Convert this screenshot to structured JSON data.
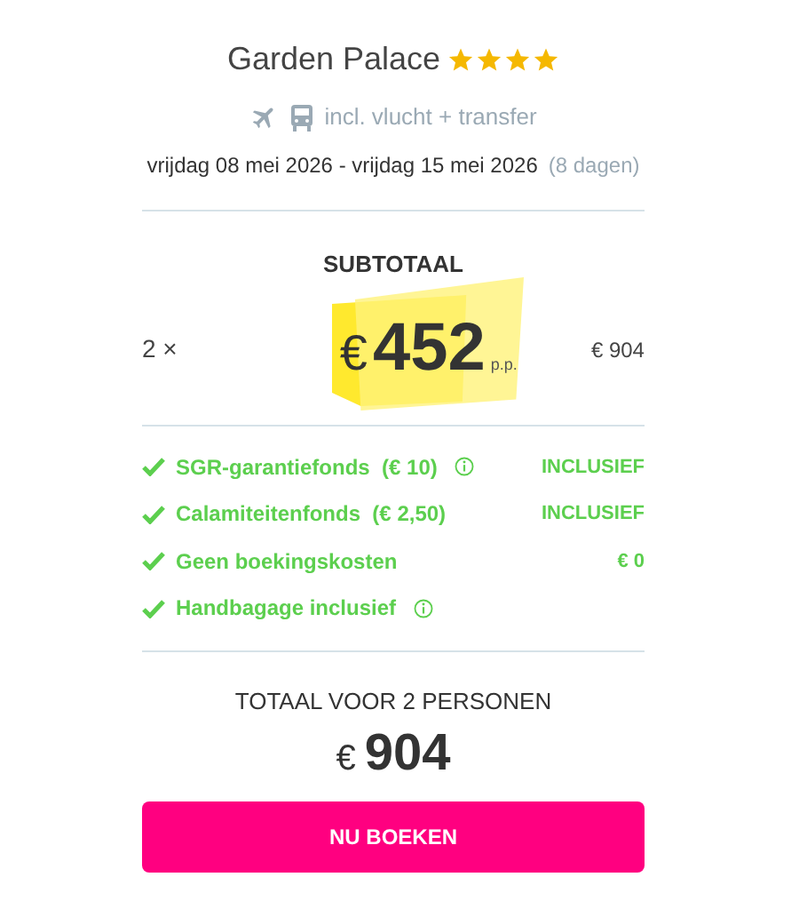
{
  "hotel": {
    "name": "Garden Palace",
    "stars": 4,
    "includes": "incl. vlucht + transfer",
    "dates": "vrijdag 08 mei 2026 - vrijdag 15 mei 2026",
    "duration": "(8 dagen)"
  },
  "subtotal": {
    "title": "SUBTOTAAL",
    "quantity": "2 ×",
    "currency": "€",
    "price": "452",
    "per": "p.p.",
    "amount": "€ 904"
  },
  "features": [
    {
      "label": "SGR-garantiefonds  (€ 10)",
      "info": true,
      "value": "INCLUSIEF"
    },
    {
      "label": "Calamiteitenfonds  (€ 2,50)",
      "info": false,
      "value": "INCLUSIEF"
    },
    {
      "label": "Geen boekingskosten",
      "info": false,
      "value": "€ 0"
    },
    {
      "label": "Handbagage inclusief",
      "info": true
    }
  ],
  "total": {
    "title": "TOTAAL VOOR 2 PERSONEN",
    "currency": "€",
    "amount": "904"
  },
  "button": "NU BOEKEN"
}
